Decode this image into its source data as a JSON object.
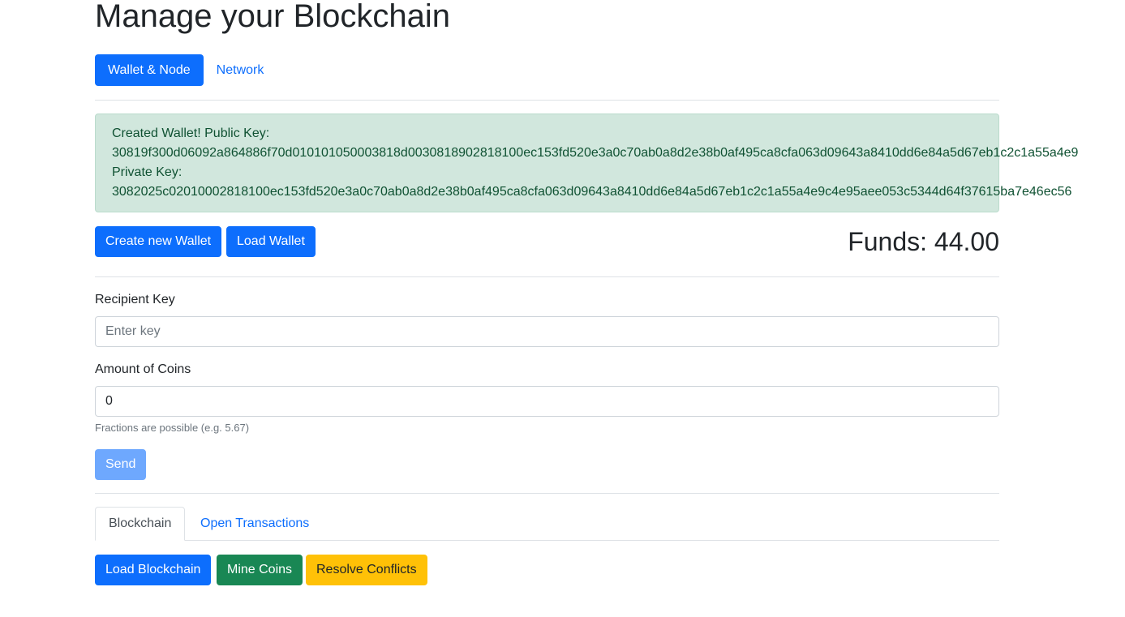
{
  "page_title": "Manage your Blockchain",
  "nav_pills": [
    {
      "label": "Wallet & Node",
      "active": true
    },
    {
      "label": "Network",
      "active": false
    }
  ],
  "alert": {
    "line1": "Created Wallet! Public Key:",
    "public_key": "30819f300d06092a864886f70d010101050003818d0030818902818100ec153fd520e3a0c70ab0a8d2e38b0af495ca8cfa063d09643a8410dd6e84a5d67eb1c2c1a55a4e9",
    "line3": "Private Key:",
    "private_key": "3082025c02010002818100ec153fd520e3a0c70ab0a8d2e38b0af495ca8cfa063d09643a8410dd6e84a5d67eb1c2c1a55a4e9c4e95aee053c5344d64f37615ba7e46ec56"
  },
  "wallet_buttons": {
    "create": "Create new Wallet",
    "load": "Load Wallet"
  },
  "funds": "Funds: 44.00",
  "form": {
    "recipient_label": "Recipient Key",
    "recipient_placeholder": "Enter key",
    "amount_label": "Amount of Coins",
    "amount_value": "0",
    "amount_help": "Fractions are possible (e.g. 5.67)",
    "send_label": "Send"
  },
  "tabs": [
    {
      "label": "Blockchain",
      "active": true
    },
    {
      "label": "Open Transactions",
      "active": false
    }
  ],
  "actions": {
    "load_blockchain": "Load Blockchain",
    "mine": "Mine Coins",
    "resolve": "Resolve Conflicts"
  },
  "colors": {
    "primary": "#0d6efd",
    "success": "#198754",
    "warning": "#ffc107",
    "alert_bg": "#d1e7dd",
    "alert_text": "#0f5132"
  }
}
